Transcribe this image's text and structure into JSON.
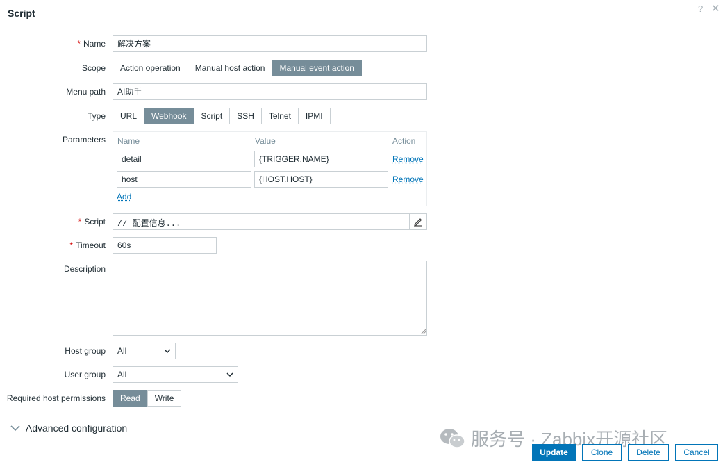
{
  "dialog": {
    "title": "Script"
  },
  "fields": {
    "name": {
      "label": "Name",
      "value": "解决方案"
    },
    "scope": {
      "label": "Scope",
      "options": [
        "Action operation",
        "Manual host action",
        "Manual event action"
      ],
      "selected": "Manual event action"
    },
    "menu_path": {
      "label": "Menu path",
      "value": "AI助手"
    },
    "type": {
      "label": "Type",
      "options": [
        "URL",
        "Webhook",
        "Script",
        "SSH",
        "Telnet",
        "IPMI"
      ],
      "selected": "Webhook"
    },
    "parameters": {
      "label": "Parameters",
      "headers": {
        "name": "Name",
        "value": "Value",
        "action": "Action"
      },
      "rows": [
        {
          "name": "detail",
          "value": "{TRIGGER.NAME}",
          "action": "Remove"
        },
        {
          "name": "host",
          "value": "{HOST.HOST}",
          "action": "Remove"
        }
      ],
      "add_label": "Add"
    },
    "script": {
      "label": "Script",
      "value": "// 配置信息..."
    },
    "timeout": {
      "label": "Timeout",
      "value": "60s"
    },
    "description": {
      "label": "Description",
      "value": ""
    },
    "host_group": {
      "label": "Host group",
      "value": "All"
    },
    "user_group": {
      "label": "User group",
      "value": "All"
    },
    "permissions": {
      "label": "Required host permissions",
      "options": [
        "Read",
        "Write"
      ],
      "selected": "Read"
    }
  },
  "advanced": {
    "label": "Advanced configuration"
  },
  "buttons": {
    "update": "Update",
    "clone": "Clone",
    "delete": "Delete",
    "cancel": "Cancel"
  },
  "watermark": {
    "text": "服务号 · Zabbix开源社区"
  },
  "icons": {
    "help": "help-icon",
    "close": "close-icon",
    "edit": "pencil-icon",
    "dropdown": "chevron-down-icon"
  },
  "colors": {
    "accent": "#0275b8",
    "selected_segment": "#768d99",
    "required": "#d40000"
  }
}
